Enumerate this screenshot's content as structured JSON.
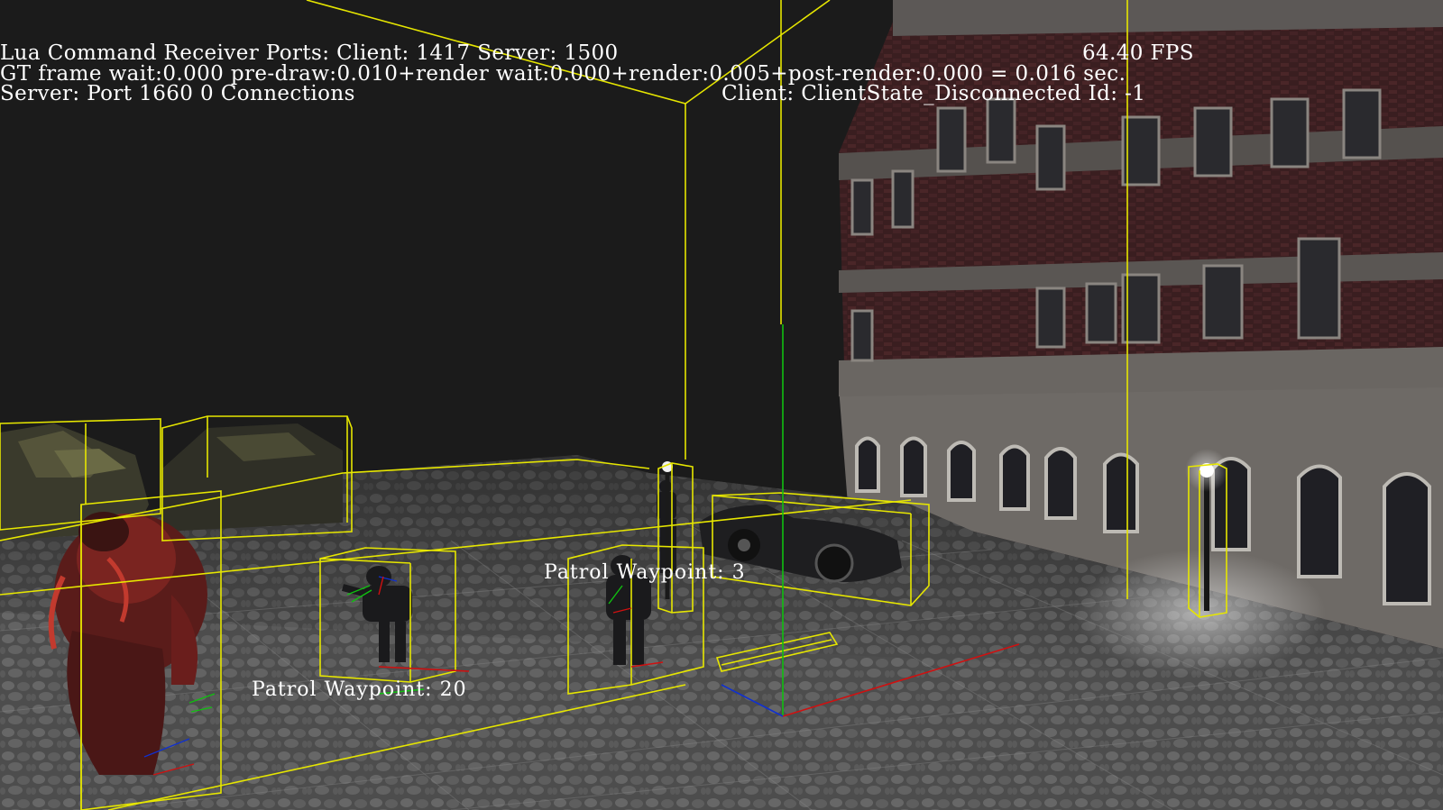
{
  "hud": {
    "line1_ports": "Lua Command Receiver Ports: Client: 1417 Server: 1500",
    "fps": "64.40 FPS",
    "line2_timing": "GT frame wait:0.000 pre-draw:0.010+render wait:0.000+render:0.005+post-render:0.000 = 0.016 sec.",
    "line3_server": "Server: Port 1660 0 Connections",
    "line3_client": "Client: ClientState_Disconnected Id: -1"
  },
  "waypoints": [
    {
      "label": "Patrol Waypoint: 3"
    },
    {
      "label": "Patrol Waypoint: 20"
    }
  ],
  "colors": {
    "background": "#1b1b1b",
    "debug_box": "#e6e600",
    "axis_x": "#d01010",
    "axis_y": "#10c010",
    "axis_z": "#1030d0",
    "hud_text": "#ffffff"
  }
}
